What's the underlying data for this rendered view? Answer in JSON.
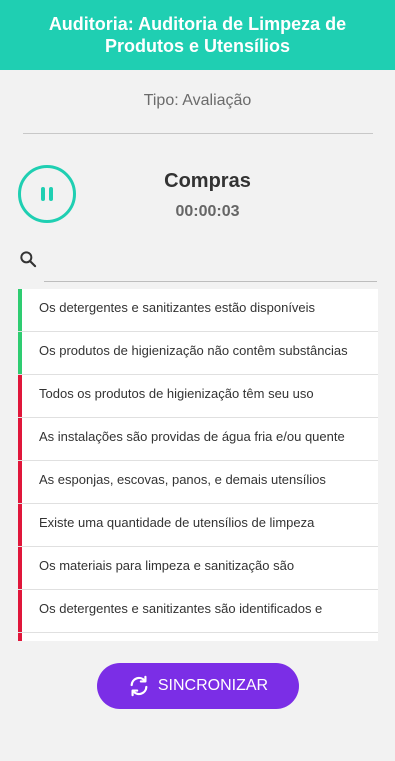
{
  "header": {
    "title": "Auditoria: Auditoria de Limpeza de Produtos e Utensílios",
    "bg": "#1fcfb2"
  },
  "tipo_label": "Tipo: Avaliação",
  "category": {
    "title": "Compras",
    "timer": "00:00:03"
  },
  "search": {
    "placeholder": ""
  },
  "items": [
    {
      "text": "Os detergentes e sanitizantes estão disponíveis",
      "status_color": "#2ecc71"
    },
    {
      "text": "Os produtos de higienização não contêm substâncias",
      "status_color": "#2ecc71"
    },
    {
      "text": "Todos os produtos de higienização têm seu uso",
      "status_color": "#e0163a"
    },
    {
      "text": "As instalações são providas de água fria e/ou quente",
      "status_color": "#e0163a"
    },
    {
      "text": "As esponjas, escovas, panos, e demais utensílios",
      "status_color": "#e0163a"
    },
    {
      "text": "Existe uma quantidade de utensílios de limpeza",
      "status_color": "#e0163a"
    },
    {
      "text": "Os materiais para limpeza e sanitização são",
      "status_color": "#e0163a"
    },
    {
      "text": "Os detergentes e sanitizantes são identificados e",
      "status_color": "#e0163a"
    },
    {
      "text": "",
      "status_color": "#e0163a"
    }
  ],
  "sync_button": {
    "label": "SINCRONIZAR",
    "color": "#7b2ee6"
  },
  "icons": {
    "pause": "pause-icon",
    "search": "search-icon",
    "sync": "sync-icon"
  }
}
